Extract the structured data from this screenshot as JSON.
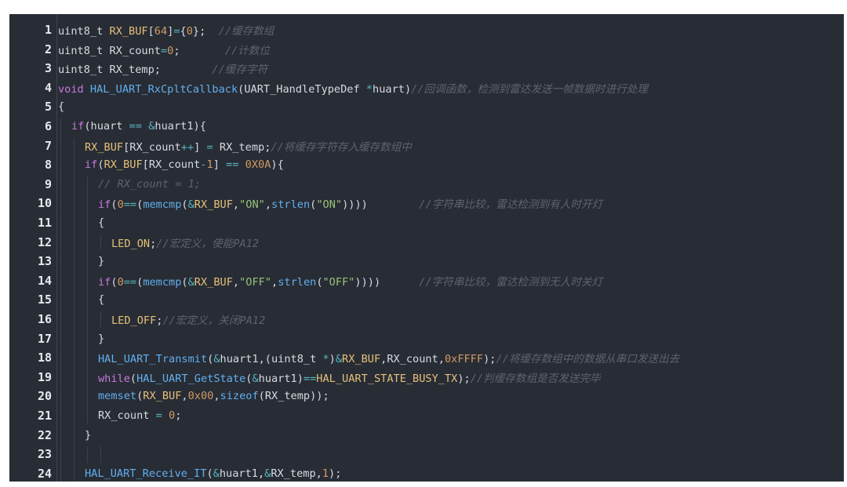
{
  "editor": {
    "lines": [
      {
        "n": "1",
        "indent": 0,
        "tokens": [
          {
            "t": "uint8_t ",
            "c": "pl"
          },
          {
            "t": "RX_BUF",
            "c": "mac"
          },
          {
            "t": "[",
            "c": "pl"
          },
          {
            "t": "64",
            "c": "num"
          },
          {
            "t": "]",
            "c": "pl"
          },
          {
            "t": "=",
            "c": "op"
          },
          {
            "t": "{",
            "c": "pl"
          },
          {
            "t": "0",
            "c": "num"
          },
          {
            "t": "};  ",
            "c": "pl"
          },
          {
            "t": "//缓存数组",
            "c": "cm"
          }
        ]
      },
      {
        "n": "2",
        "indent": 0,
        "tokens": [
          {
            "t": "uint8_t RX_count",
            "c": "pl"
          },
          {
            "t": "=",
            "c": "op"
          },
          {
            "t": "0",
            "c": "num"
          },
          {
            "t": ";       ",
            "c": "pl"
          },
          {
            "t": "//计数位",
            "c": "cm"
          }
        ]
      },
      {
        "n": "3",
        "indent": 0,
        "tokens": [
          {
            "t": "uint8_t RX_temp;        ",
            "c": "pl"
          },
          {
            "t": "//缓存字符",
            "c": "cm"
          }
        ]
      },
      {
        "n": "4",
        "indent": 0,
        "tokens": [
          {
            "t": "void ",
            "c": "kw"
          },
          {
            "t": "HAL_UART_RxCpltCallback",
            "c": "fn"
          },
          {
            "t": "(UART_HandleTypeDef ",
            "c": "pl"
          },
          {
            "t": "*",
            "c": "op"
          },
          {
            "t": "huart)",
            "c": "pl"
          },
          {
            "t": "//回调函数，检测到雷达发送一帧数据时进行处理",
            "c": "cm"
          }
        ]
      },
      {
        "n": "5",
        "indent": 0,
        "tokens": [
          {
            "t": "{",
            "c": "pl"
          }
        ]
      },
      {
        "n": "6",
        "indent": 1,
        "tokens": [
          {
            "t": "if",
            "c": "kw"
          },
          {
            "t": "(huart ",
            "c": "pl"
          },
          {
            "t": "==",
            "c": "op"
          },
          {
            "t": " ",
            "c": "pl"
          },
          {
            "t": "&",
            "c": "op"
          },
          {
            "t": "huart1){",
            "c": "pl"
          }
        ]
      },
      {
        "n": "7",
        "indent": 2,
        "tokens": [
          {
            "t": "RX_BUF",
            "c": "mac"
          },
          {
            "t": "[RX_count",
            "c": "pl"
          },
          {
            "t": "++",
            "c": "op"
          },
          {
            "t": "] ",
            "c": "pl"
          },
          {
            "t": "=",
            "c": "op"
          },
          {
            "t": " RX_temp;",
            "c": "pl"
          },
          {
            "t": "//将缓存字符存入缓存数组中",
            "c": "cm"
          }
        ]
      },
      {
        "n": "8",
        "indent": 2,
        "tokens": [
          {
            "t": "if",
            "c": "kw"
          },
          {
            "t": "(",
            "c": "pl"
          },
          {
            "t": "RX_BUF",
            "c": "mac"
          },
          {
            "t": "[RX_count",
            "c": "pl"
          },
          {
            "t": "-",
            "c": "op"
          },
          {
            "t": "1",
            "c": "num"
          },
          {
            "t": "] ",
            "c": "pl"
          },
          {
            "t": "==",
            "c": "op"
          },
          {
            "t": " ",
            "c": "pl"
          },
          {
            "t": "0X0A",
            "c": "num"
          },
          {
            "t": "){",
            "c": "pl"
          }
        ]
      },
      {
        "n": "9",
        "indent": 3,
        "tokens": [
          {
            "t": "// RX_count = 1;",
            "c": "cm"
          }
        ]
      },
      {
        "n": "10",
        "indent": 3,
        "tokens": [
          {
            "t": "if",
            "c": "kw"
          },
          {
            "t": "(",
            "c": "pl"
          },
          {
            "t": "0",
            "c": "num"
          },
          {
            "t": "==",
            "c": "op"
          },
          {
            "t": "(",
            "c": "pl"
          },
          {
            "t": "memcmp",
            "c": "fn"
          },
          {
            "t": "(",
            "c": "pl"
          },
          {
            "t": "&",
            "c": "op"
          },
          {
            "t": "RX_BUF",
            "c": "mac"
          },
          {
            "t": ",",
            "c": "pl"
          },
          {
            "t": "\"ON\"",
            "c": "str"
          },
          {
            "t": ",",
            "c": "pl"
          },
          {
            "t": "strlen",
            "c": "fn"
          },
          {
            "t": "(",
            "c": "pl"
          },
          {
            "t": "\"ON\"",
            "c": "str"
          },
          {
            "t": "))))        ",
            "c": "pl"
          },
          {
            "t": "//字符串比较，雷达检测到有人时开灯",
            "c": "cm"
          }
        ]
      },
      {
        "n": "11",
        "indent": 3,
        "tokens": [
          {
            "t": "{",
            "c": "pl"
          }
        ]
      },
      {
        "n": "12",
        "indent": 4,
        "tokens": [
          {
            "t": "LED_ON",
            "c": "mac"
          },
          {
            "t": ";",
            "c": "pl"
          },
          {
            "t": "//宏定义，使能PA12",
            "c": "cm"
          }
        ]
      },
      {
        "n": "13",
        "indent": 3,
        "tokens": [
          {
            "t": "}",
            "c": "pl"
          }
        ]
      },
      {
        "n": "14",
        "indent": 3,
        "tokens": [
          {
            "t": "if",
            "c": "kw"
          },
          {
            "t": "(",
            "c": "pl"
          },
          {
            "t": "0",
            "c": "num"
          },
          {
            "t": "==",
            "c": "op"
          },
          {
            "t": "(",
            "c": "pl"
          },
          {
            "t": "memcmp",
            "c": "fn"
          },
          {
            "t": "(",
            "c": "pl"
          },
          {
            "t": "&",
            "c": "op"
          },
          {
            "t": "RX_BUF",
            "c": "mac"
          },
          {
            "t": ",",
            "c": "pl"
          },
          {
            "t": "\"OFF\"",
            "c": "str"
          },
          {
            "t": ",",
            "c": "pl"
          },
          {
            "t": "strlen",
            "c": "fn"
          },
          {
            "t": "(",
            "c": "pl"
          },
          {
            "t": "\"OFF\"",
            "c": "str"
          },
          {
            "t": "))))      ",
            "c": "pl"
          },
          {
            "t": "//字符串比较，雷达检测到无人时关灯",
            "c": "cm"
          }
        ]
      },
      {
        "n": "15",
        "indent": 3,
        "tokens": [
          {
            "t": "{",
            "c": "pl"
          }
        ]
      },
      {
        "n": "16",
        "indent": 4,
        "tokens": [
          {
            "t": "LED_OFF",
            "c": "mac"
          },
          {
            "t": ";",
            "c": "pl"
          },
          {
            "t": "//宏定义，关闭PA12",
            "c": "cm"
          }
        ]
      },
      {
        "n": "17",
        "indent": 3,
        "tokens": [
          {
            "t": "}",
            "c": "pl"
          }
        ]
      },
      {
        "n": "18",
        "indent": 3,
        "tokens": [
          {
            "t": "HAL_UART_Transmit",
            "c": "fn"
          },
          {
            "t": "(",
            "c": "pl"
          },
          {
            "t": "&",
            "c": "op"
          },
          {
            "t": "huart1,(uint8_t ",
            "c": "pl"
          },
          {
            "t": "*",
            "c": "op"
          },
          {
            "t": ")",
            "c": "pl"
          },
          {
            "t": "&",
            "c": "op"
          },
          {
            "t": "RX_BUF",
            "c": "mac"
          },
          {
            "t": ",RX_count,",
            "c": "pl"
          },
          {
            "t": "0xFFFF",
            "c": "num"
          },
          {
            "t": ");",
            "c": "pl"
          },
          {
            "t": "//将缓存数组中的数据从串口发送出去",
            "c": "cm"
          }
        ]
      },
      {
        "n": "19",
        "indent": 3,
        "tokens": [
          {
            "t": "while",
            "c": "kw"
          },
          {
            "t": "(",
            "c": "pl"
          },
          {
            "t": "HAL_UART_GetState",
            "c": "fn"
          },
          {
            "t": "(",
            "c": "pl"
          },
          {
            "t": "&",
            "c": "op"
          },
          {
            "t": "huart1)",
            "c": "pl"
          },
          {
            "t": "==",
            "c": "op"
          },
          {
            "t": "HAL_UART_STATE_BUSY_TX",
            "c": "mac"
          },
          {
            "t": ");",
            "c": "pl"
          },
          {
            "t": "//判缓存数组是否发送完毕",
            "c": "cm"
          }
        ]
      },
      {
        "n": "20",
        "indent": 3,
        "tokens": [
          {
            "t": "memset",
            "c": "fn"
          },
          {
            "t": "(",
            "c": "pl"
          },
          {
            "t": "RX_BUF",
            "c": "mac"
          },
          {
            "t": ",",
            "c": "pl"
          },
          {
            "t": "0x00",
            "c": "num"
          },
          {
            "t": ",",
            "c": "pl"
          },
          {
            "t": "sizeof",
            "c": "fn"
          },
          {
            "t": "(RX_temp));",
            "c": "pl"
          }
        ]
      },
      {
        "n": "21",
        "indent": 3,
        "tokens": [
          {
            "t": "RX_count ",
            "c": "pl"
          },
          {
            "t": "=",
            "c": "op"
          },
          {
            "t": " ",
            "c": "pl"
          },
          {
            "t": "0",
            "c": "num"
          },
          {
            "t": ";",
            "c": "pl"
          }
        ]
      },
      {
        "n": "22",
        "indent": 2,
        "tokens": [
          {
            "t": "}",
            "c": "pl"
          }
        ]
      },
      {
        "n": "23",
        "indent": 0,
        "tokens": []
      },
      {
        "n": "24",
        "indent": 2,
        "tokens": [
          {
            "t": "HAL_UART_Receive_IT",
            "c": "fn"
          },
          {
            "t": "(",
            "c": "pl"
          },
          {
            "t": "&",
            "c": "op"
          },
          {
            "t": "huart1,",
            "c": "pl"
          },
          {
            "t": "&",
            "c": "op"
          },
          {
            "t": "RX_temp,",
            "c": "pl"
          },
          {
            "t": "1",
            "c": "num"
          },
          {
            "t": ");",
            "c": "pl"
          }
        ]
      }
    ]
  }
}
